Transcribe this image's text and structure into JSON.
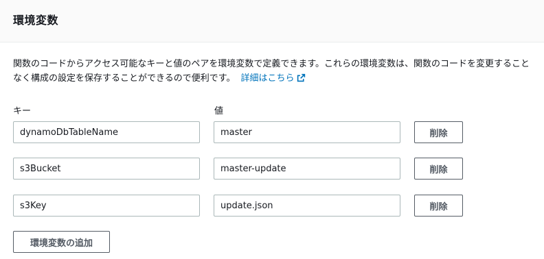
{
  "header": {
    "title": "環境変数"
  },
  "description": {
    "text": "関数のコードからアクセス可能なキーと値のペアを環境変数で定義できます。これらの環境変数は、関数のコードを変更することなく構成の設定を保存することができるので便利です。",
    "learn_more": "詳細はこちら",
    "learn_more_icon": "external-link-icon"
  },
  "columns": {
    "key": "キー",
    "value": "値"
  },
  "variables": [
    {
      "key": "dynamoDbTableName",
      "value": "master",
      "remove_label": "削除"
    },
    {
      "key": "s3Bucket",
      "value": "master-update",
      "remove_label": "削除"
    },
    {
      "key": "s3Key",
      "value": "update.json",
      "remove_label": "削除"
    }
  ],
  "add_button": "環境変数の追加",
  "colors": {
    "link": "#0073bb",
    "border": "#aab7b8",
    "button_text": "#545b64",
    "header_bg": "#fafafa"
  }
}
